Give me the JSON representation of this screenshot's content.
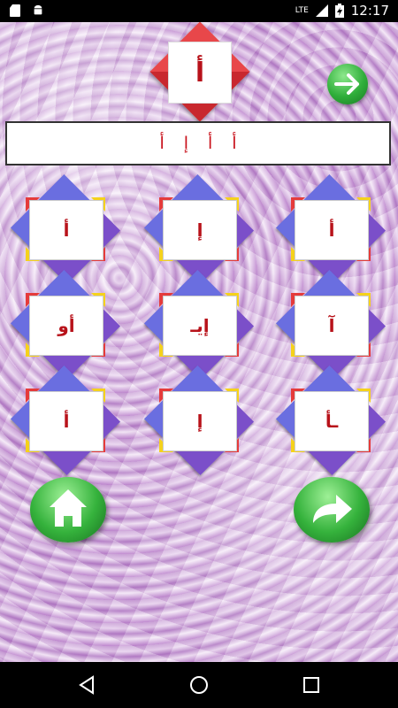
{
  "status_bar": {
    "time": "12:17",
    "network": "LTE",
    "icons": [
      "sd-card-icon",
      "android-icon",
      "signal-icon",
      "battery-charging-icon"
    ]
  },
  "header": {
    "letter": "أ",
    "forward_icon": "arrow-right-icon"
  },
  "sentence": [
    "أ",
    "أ",
    "إ",
    "أ"
  ],
  "tiles": [
    {
      "label": "أ"
    },
    {
      "label": "إ"
    },
    {
      "label": "أ"
    },
    {
      "label": "أو"
    },
    {
      "label": "إيـ"
    },
    {
      "label": "آ"
    },
    {
      "label": "أ"
    },
    {
      "label": "إ"
    },
    {
      "label": "ـأ"
    }
  ],
  "bottom_buttons": {
    "home_icon": "home-icon",
    "next_icon": "forward-arrow-icon"
  },
  "nav": {
    "back_icon": "back-triangle-icon",
    "home_icon": "home-circle-icon",
    "recents_icon": "recents-square-icon"
  },
  "colors": {
    "letter": "#b8121a",
    "button_green": "#2fae3a",
    "background": "#c79ad6"
  }
}
